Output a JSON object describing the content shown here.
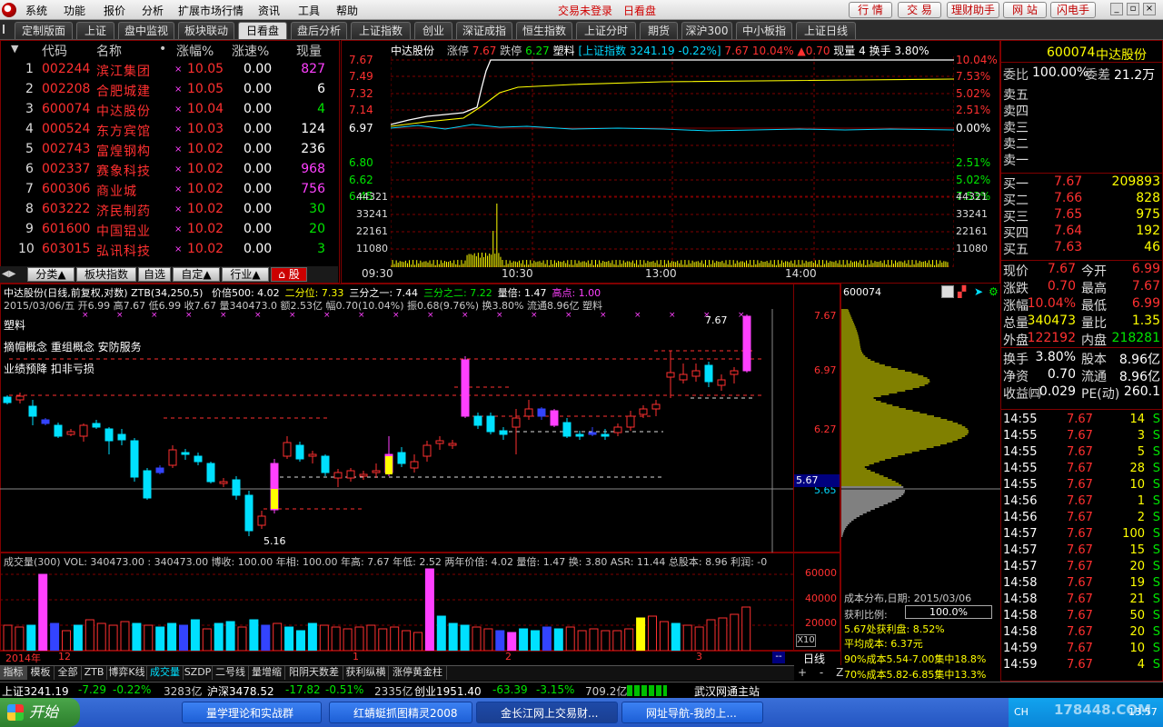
{
  "menu": {
    "items": [
      "系统",
      "功能",
      "报价",
      "分析",
      "扩展市场行情",
      "资讯",
      "工具",
      "帮助"
    ],
    "trade_status": "交易未登录",
    "theme": "日看盘",
    "buttons": [
      "行 情",
      "交 易",
      "理财助手",
      "网 站",
      "闪电手"
    ]
  },
  "tabs": [
    "定制版面",
    "上证",
    "盘中监视",
    "板块联动",
    "日看盘",
    "盘后分析",
    "上证指数",
    "创业",
    "深证成指",
    "恒生指数",
    "上证分时",
    "期货",
    "深沪300",
    "中小板指",
    "上证日线"
  ],
  "quote_list": {
    "headers": {
      "sort": "▼",
      "code": "代码",
      "name": "名称",
      "pct": "涨幅%",
      "speed": "涨速%",
      "vol": "现量"
    },
    "rows": [
      {
        "n": "1",
        "code": "002244",
        "name": "滨江集团",
        "pct": "10.05",
        "speed": "0.00",
        "vol": "827",
        "vcolor": "#ff40ff"
      },
      {
        "n": "2",
        "code": "002208",
        "name": "合肥城建",
        "pct": "10.05",
        "speed": "0.00",
        "vol": "6",
        "vcolor": "#ffffff"
      },
      {
        "n": "3",
        "code": "600074",
        "name": "中达股份",
        "pct": "10.04",
        "speed": "0.00",
        "vol": "4",
        "vcolor": "#00e600"
      },
      {
        "n": "4",
        "code": "000524",
        "name": "东方宾馆",
        "pct": "10.03",
        "speed": "0.00",
        "vol": "124",
        "vcolor": "#ffffff"
      },
      {
        "n": "5",
        "code": "002743",
        "name": "富煌钢构",
        "pct": "10.02",
        "speed": "0.00",
        "vol": "236",
        "vcolor": "#ffffff"
      },
      {
        "n": "6",
        "code": "002337",
        "name": "赛象科技",
        "pct": "10.02",
        "speed": "0.00",
        "vol": "968",
        "vcolor": "#ff40ff"
      },
      {
        "n": "7",
        "code": "600306",
        "name": "商业城",
        "pct": "10.02",
        "speed": "0.00",
        "vol": "756",
        "vcolor": "#ff40ff"
      },
      {
        "n": "8",
        "code": "603222",
        "name": "济民制药",
        "pct": "10.02",
        "speed": "0.00",
        "vol": "30",
        "vcolor": "#00e600"
      },
      {
        "n": "9",
        "code": "601600",
        "name": "中国铝业",
        "pct": "10.02",
        "speed": "0.00",
        "vol": "20",
        "vcolor": "#00e600"
      },
      {
        "n": "10",
        "code": "603015",
        "name": "弘讯科技",
        "pct": "10.02",
        "speed": "0.00",
        "vol": "3",
        "vcolor": "#00e600"
      }
    ]
  },
  "subtabs": [
    "分类▲",
    "板块指数",
    "自选",
    "自定▲",
    "行业▲",
    "⌂ 股"
  ],
  "intraday": {
    "header": {
      "name": "中达股份",
      "zt_label": "涨停",
      "zt": "7.67",
      "dt_label": "跌停",
      "dt": "6.27",
      "tag": "塑料",
      "index": "[上证指数 3241.19 -0.22%]",
      "price": "7.67",
      "pct": "10.04%",
      "chg": "▲0.70",
      "xl": "现量 4",
      "hs": "换手 3.80%"
    },
    "price_ticks": [
      "7.67",
      "7.49",
      "7.32",
      "7.14",
      "6.97",
      "6.80",
      "6.62",
      "6.45"
    ],
    "pct_ticks": [
      "10.04%",
      "7.53%",
      "5.02%",
      "2.51%",
      "0.00%",
      "2.51%",
      "5.02%",
      "7.53%"
    ],
    "vol_ticks": [
      "44321",
      "33241",
      "22161",
      "11080"
    ],
    "time_ticks": [
      "09:30",
      "10:30",
      "13:00",
      "14:00"
    ]
  },
  "stock_info": {
    "code": "600074",
    "name": "中达股份",
    "wb_label": "委比",
    "wb": "100.00%",
    "wc_label": "委差",
    "wc": "21.2万",
    "asks": [
      "卖五",
      "卖四",
      "卖三",
      "卖二",
      "卖一"
    ],
    "bids": [
      {
        "l": "买一",
        "p": "7.67",
        "v": "209893"
      },
      {
        "l": "买二",
        "p": "7.66",
        "v": "828"
      },
      {
        "l": "买三",
        "p": "7.65",
        "v": "975"
      },
      {
        "l": "买四",
        "p": "7.64",
        "v": "192"
      },
      {
        "l": "买五",
        "p": "7.63",
        "v": "46"
      }
    ],
    "stats": [
      {
        "l1": "现价",
        "v1": "7.67",
        "l2": "今开",
        "v2": "6.99"
      },
      {
        "l1": "涨跌",
        "v1": "0.70",
        "l2": "最高",
        "v2": "7.67"
      },
      {
        "l1": "涨幅",
        "v1": "10.04%",
        "l2": "最低",
        "v2": "6.99"
      },
      {
        "l1": "总量",
        "v1": "340473",
        "l2": "量比",
        "v2": "1.35"
      },
      {
        "l1": "外盘",
        "v1": "122192",
        "l2": "内盘",
        "v2": "218281"
      }
    ],
    "stats2": [
      {
        "l1": "换手",
        "v1": "3.80%",
        "l2": "股本",
        "v2": "8.96亿"
      },
      {
        "l1": "净资",
        "v1": "0.70",
        "l2": "流通",
        "v2": "8.96亿"
      },
      {
        "l1": "收益㈣",
        "v1": "0.029",
        "l2": "PE(动)",
        "v2": "260.1"
      }
    ],
    "ticks": [
      {
        "t": "14:55",
        "p": "7.67",
        "v": "14",
        "s": "S"
      },
      {
        "t": "14:55",
        "p": "7.67",
        "v": "3",
        "s": "S"
      },
      {
        "t": "14:55",
        "p": "7.67",
        "v": "5",
        "s": "S"
      },
      {
        "t": "14:55",
        "p": "7.67",
        "v": "28",
        "s": "S"
      },
      {
        "t": "14:55",
        "p": "7.67",
        "v": "10",
        "s": "S"
      },
      {
        "t": "14:56",
        "p": "7.67",
        "v": "1",
        "s": "S"
      },
      {
        "t": "14:56",
        "p": "7.67",
        "v": "2",
        "s": "S"
      },
      {
        "t": "14:57",
        "p": "7.67",
        "v": "100",
        "s": "S"
      },
      {
        "t": "14:57",
        "p": "7.67",
        "v": "15",
        "s": "S"
      },
      {
        "t": "14:57",
        "p": "7.67",
        "v": "20",
        "s": "S"
      },
      {
        "t": "14:58",
        "p": "7.67",
        "v": "19",
        "s": "S"
      },
      {
        "t": "14:58",
        "p": "7.67",
        "v": "21",
        "s": "S"
      },
      {
        "t": "14:58",
        "p": "7.67",
        "v": "50",
        "s": "S"
      },
      {
        "t": "14:58",
        "p": "7.67",
        "v": "20",
        "s": "S"
      },
      {
        "t": "14:59",
        "p": "7.67",
        "v": "10",
        "s": "S"
      },
      {
        "t": "14:59",
        "p": "7.67",
        "v": "4",
        "s": "S"
      }
    ]
  },
  "kline": {
    "title": "中达股份(日线,前复权,对数) ZTB(34,250,5)",
    "ind": [
      {
        "t": "价倍500: 4.02",
        "c": "#ffffff"
      },
      {
        "t": "二分位: 7.33",
        "c": "#ffff00"
      },
      {
        "t": "三分之一: 7.44",
        "c": "#ffffff"
      },
      {
        "t": "三分之二: 7.22",
        "c": "#00e600"
      },
      {
        "t": "量倍: 1.47",
        "c": "#ffffff"
      },
      {
        "t": "高点: 1.00",
        "c": "#ff40ff"
      }
    ],
    "ohlc_line": "2015/03/06/五 开6.99 高7.67 低6.99 收7.67 量340473.0 额2.53亿 幅0.70(10.04%) 振0.68(9.76%) 换3.80% 流通8.96亿 塑料",
    "notes": [
      "塑料",
      "摘帽概念 重组概念 安防服务",
      "业绩预降 扣非亏损"
    ],
    "high_label": "7.67",
    "low_label": "5.16",
    "right_ticks": [
      "7.67",
      "6.97",
      "6.27",
      "5.65"
    ],
    "cursor_price": "5.67",
    "date_labels": [
      "2014年",
      "12",
      "1",
      "2",
      "3"
    ],
    "daily_label": "日线"
  },
  "chip": {
    "code": "600074",
    "title": "成本分布,日期: 2015/03/06",
    "profit_label": "获利比例:",
    "profit": "100.0%",
    "line1": "5.67处获利盘: 8.52%",
    "line2": "平均成本: 6.37元",
    "line3": "90%成本5.54-7.00集中18.8%",
    "line4": "70%成本5.82-6.85集中13.3%"
  },
  "volume": {
    "header": "成交量(300) VOL: 340473.00  : 340473.00 博收: 100.00 年相: 100.00 年高: 7.67 年低: 2.52 两年价倍: 4.02 量倍: 1.47 换: 3.80 ASR: 11.44 总股本: 8.96 利润: -0",
    "ticks": [
      "60000",
      "40000",
      "20000"
    ],
    "x10": "X10"
  },
  "bottom_tabs": [
    "指标",
    "模板",
    "全部",
    "ZTB",
    "博弈K线",
    "成交量",
    "SZDP",
    "二号线",
    "量增缩",
    "阳阴天数差",
    "获利纵横",
    "涨停黄金柱"
  ],
  "status": {
    "sh": "上证3241.19",
    "sh_chg": "-7.29",
    "sh_pct": "-0.22%",
    "sh_amt": "3283亿",
    "sz": "沪深3478.52",
    "sz_chg": "-17.82",
    "sz_pct": "-0.51%",
    "sz_amt": "2335亿",
    "cy": "创业1951.40",
    "cy_chg": "-63.39",
    "cy_pct": "-3.15%",
    "cy_amt": "709.2亿",
    "site": "武汉网通主站"
  },
  "taskbar": {
    "start": "开始",
    "tasks": [
      "量学理论和实战群",
      "红蜻蜓抓图精灵2008",
      "金长江网上交易财...",
      "网址导航-我的上..."
    ],
    "clock": "13:57",
    "ime": "CH",
    "watermark": "178448.COM"
  }
}
